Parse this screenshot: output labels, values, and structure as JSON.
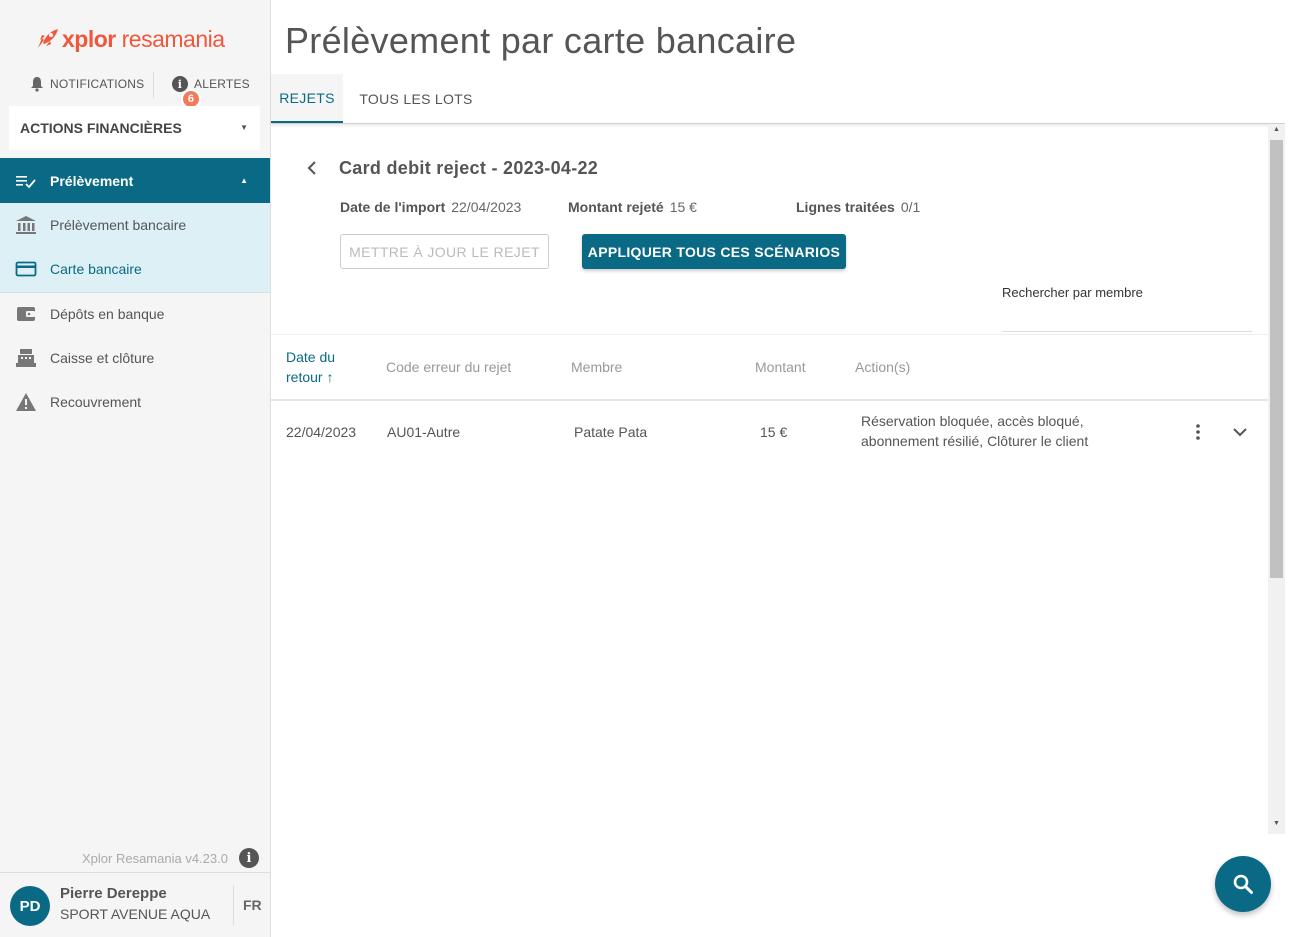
{
  "app": {
    "logo_x": "xplor",
    "logo_r": " resamania"
  },
  "top_links": {
    "notifications": "NOTIFICATIONS",
    "alerts": "ALERTES",
    "alerts_count": "6"
  },
  "section_select": {
    "label": "ACTIONS FINANCIÈRES"
  },
  "sidebar": {
    "main_item": "Prélèvement",
    "sub_items": [
      {
        "label": "Prélèvement bancaire"
      },
      {
        "label": "Carte bancaire"
      }
    ],
    "items": [
      {
        "label": "Dépôts en banque"
      },
      {
        "label": "Caisse et clôture"
      },
      {
        "label": "Recouvrement"
      }
    ],
    "version": "Xplor Resamania v4.23.0"
  },
  "user": {
    "initials": "PD",
    "name": "Pierre Dereppe",
    "club": "SPORT AVENUE AQUA",
    "lang": "FR"
  },
  "page": {
    "title": "Prélèvement par carte bancaire"
  },
  "tabs": [
    {
      "label": "REJETS"
    },
    {
      "label": "TOUS LES LOTS"
    }
  ],
  "detail": {
    "title": "Card debit reject - 2023-04-22",
    "import_date_label": "Date de l'import",
    "import_date": "22/04/2023",
    "amount_label": "Montant rejeté",
    "amount": "15 €",
    "lines_label": "Lignes traitées",
    "lines": "0/1",
    "update_button": "METTRE À JOUR LE REJET",
    "apply_button": "APPLIQUER TOUS CES SCÉNARIOS",
    "search_label": "Rechercher par membre"
  },
  "table": {
    "headers": {
      "date_line1": "Date du",
      "date_line2": "retour ↑",
      "code": "Code erreur du rejet",
      "member": "Membre",
      "amount": "Montant",
      "actions": "Action(s)"
    },
    "rows": [
      {
        "date": "22/04/2023",
        "code": "AU01-Autre",
        "member": "Patate Pata",
        "amount": "15 €",
        "actions": "Réservation bloquée, accès bloqué, abonnement résilié, Clôturer le client"
      }
    ]
  },
  "colors": {
    "primary": "#0a6a86",
    "accent": "#f0573c",
    "badge": "#f07a5a"
  }
}
